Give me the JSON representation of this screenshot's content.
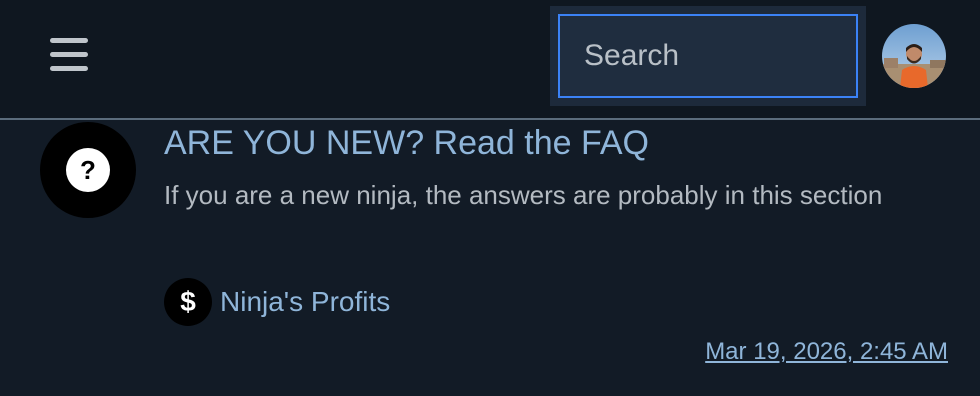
{
  "header": {
    "menu_icon": "hamburger-menu-icon",
    "search": {
      "placeholder": "Search",
      "value": ""
    },
    "avatar_icon": "user-avatar"
  },
  "post": {
    "icon": "question-mark-icon",
    "icon_glyph": "?",
    "title": "ARE YOU NEW? Read the FAQ",
    "description": "If you are a new ninja, the answers are probably in this section",
    "category": {
      "icon": "dollar-icon",
      "icon_glyph": "$",
      "label": "Ninja's Profits"
    },
    "timestamp": "Mar 19, 2026, 2:45 AM"
  },
  "colors": {
    "background": "#121b26",
    "header_bg": "#0f1720",
    "link": "#8fb5d9",
    "text_muted": "#b3bac1",
    "search_border": "#3b82f6"
  }
}
